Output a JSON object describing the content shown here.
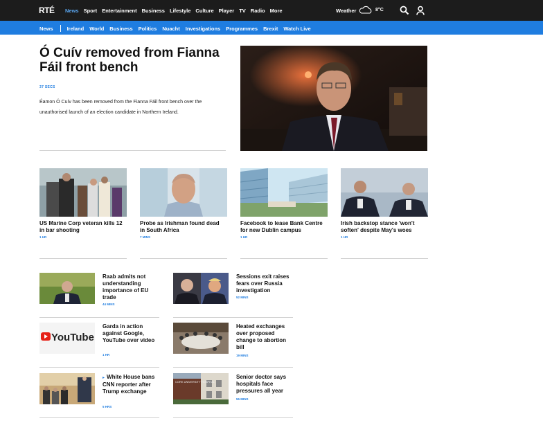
{
  "header": {
    "logo": "RTÉ",
    "nav": [
      "News",
      "Sport",
      "Entertainment",
      "Business",
      "Lifestyle",
      "Culture",
      "Player",
      "TV",
      "Radio",
      "More"
    ],
    "active_nav": "News",
    "weather_label": "Weather",
    "temperature": "8°C"
  },
  "subnav": {
    "first": "News",
    "items": [
      "Ireland",
      "World",
      "Business",
      "Politics",
      "Nuacht",
      "Investigations",
      "Programmes",
      "Brexit",
      "Watch Live"
    ]
  },
  "lead": {
    "title": "Ó Cuív removed from Fianna Fáil front bench",
    "time": "37 SECS",
    "summary": "Éamon Ó Cuív has been removed from the Fianna Fáil front bench over the unauthorised launch of an election candidate in Northern Ireland."
  },
  "cards": [
    {
      "title": "US Marine Corp veteran kills 12 in bar shooting",
      "time": "1 HR"
    },
    {
      "title": "Probe as Irishman found dead in South Africa",
      "time": "7 MINS"
    },
    {
      "title": "Facebook to lease Bank Centre for new Dublin campus",
      "time": "1 HR"
    },
    {
      "title": "Irish backstop stance 'won't soften' despite May's woes",
      "time": "1 HR"
    }
  ],
  "list_left": [
    {
      "title": "Raab admits not understanding importance of EU trade",
      "time": "44 MINS"
    },
    {
      "title": "Garda in action against Google, YouTube over video",
      "time": "1 HR"
    },
    {
      "title": "White House bans CNN reporter after Trump exchange",
      "time": "5 HRS",
      "video": true
    }
  ],
  "list_right": [
    {
      "title": "Sessions exit raises fears over Russia investigation",
      "time": "52 MINS"
    },
    {
      "title": "Heated exchanges over proposed change to abortion bill",
      "time": "19 MINS"
    },
    {
      "title": "Senior doctor says hospitals face pressures all year",
      "time": "55 MINS"
    }
  ],
  "youtube_logo_text": "YouTube",
  "hospital_sign_text": "CORK UNIVERSITY HOSPITAL",
  "colors": {
    "topbar": "#1c1c1c",
    "subbar": "#1f7de0",
    "accent": "#1f7de0"
  }
}
